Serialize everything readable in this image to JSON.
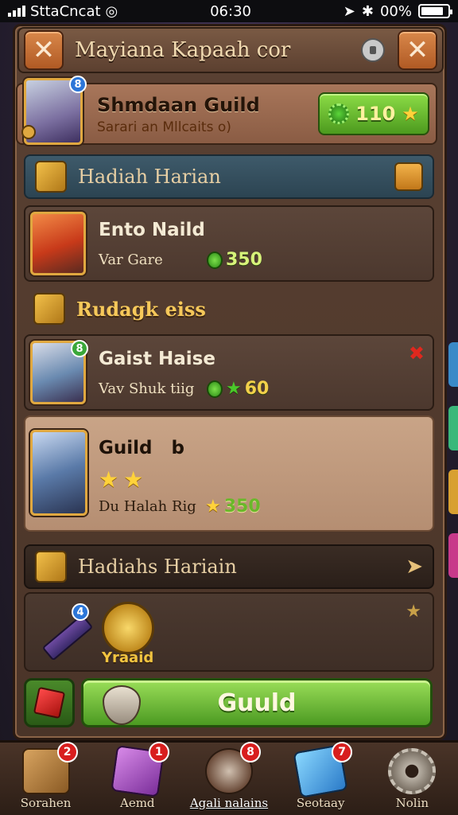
{
  "status_bar": {
    "carrier": "SttaCncat",
    "time": "06:30",
    "battery": "00%",
    "battery_level": 0.85
  },
  "title_bar": {
    "title": "Mayiana Kapaah cor"
  },
  "guild": {
    "name": "Shmdaan Guild",
    "subtitle": "Sarari an Mllcaits o)",
    "badge": "8",
    "points": "110"
  },
  "sections": [
    {
      "title": "Hadiah Harian"
    },
    {
      "title": "Rudagk eiss"
    },
    {
      "title": "Hadiahs Hariain"
    }
  ],
  "quests": [
    {
      "title": "Ento Naild",
      "subtitle": "Var Gare",
      "reward": "350"
    },
    {
      "title": "Gaist Haise",
      "subtitle": "Vav Shuk tiig",
      "reward": "60",
      "badge": "8"
    },
    {
      "title": "Guild",
      "title_suffix": "b",
      "subtitle": "Du Halah Rig",
      "reward": "350",
      "stars": 2
    }
  ],
  "reward_panel": {
    "coin_label": "Yraaid",
    "badge": "4"
  },
  "main_button": {
    "label": "Guuld"
  },
  "bottom_nav": [
    {
      "label": "Sorahen",
      "badge": "2",
      "icon": "crate-icon"
    },
    {
      "label": "Aemd",
      "badge": "1",
      "icon": "gem-icon"
    },
    {
      "label": "Agali nalains",
      "badge": "8",
      "icon": "pot-icon",
      "active": true
    },
    {
      "label": "Seotaay",
      "badge": "7",
      "icon": "shard-icon"
    },
    {
      "label": "Nolin",
      "icon": "gear-icon"
    }
  ],
  "colors": {
    "accent_green": "#5cb82a",
    "frame_brown": "#5a4133",
    "gold": "#f2c440",
    "alert_red": "#d81e1e"
  }
}
